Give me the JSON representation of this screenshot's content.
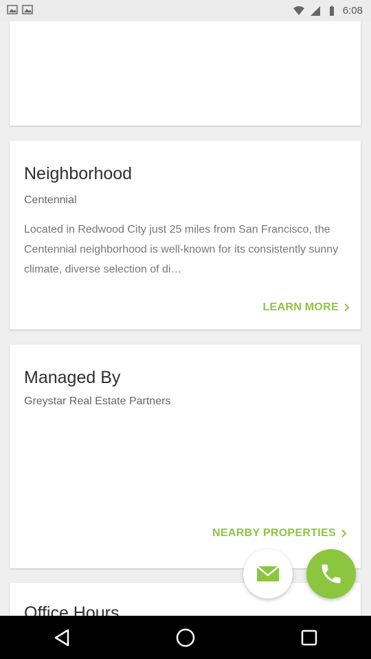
{
  "status_bar": {
    "time": "6:08"
  },
  "neighborhood": {
    "title": "Neighborhood",
    "name": "Centennial",
    "description": "Located in Redwood City just 25 miles from San Francisco, the Centennial neighborhood is well-known for its consistently sunny climate, diverse selection of di…",
    "link_label": "LEARN MORE"
  },
  "managed_by": {
    "title": "Managed By",
    "company": "Greystar Real Estate Partners",
    "link_label": "NEARBY PROPERTIES"
  },
  "office_hours": {
    "title": "Office Hours"
  },
  "colors": {
    "accent": "#8cc63f"
  },
  "icons": {
    "email_fab": "envelope-icon",
    "call_fab": "phone-icon",
    "nav_back": "back-triangle-icon",
    "nav_home": "home-circle-icon",
    "nav_recents": "recents-square-icon"
  }
}
